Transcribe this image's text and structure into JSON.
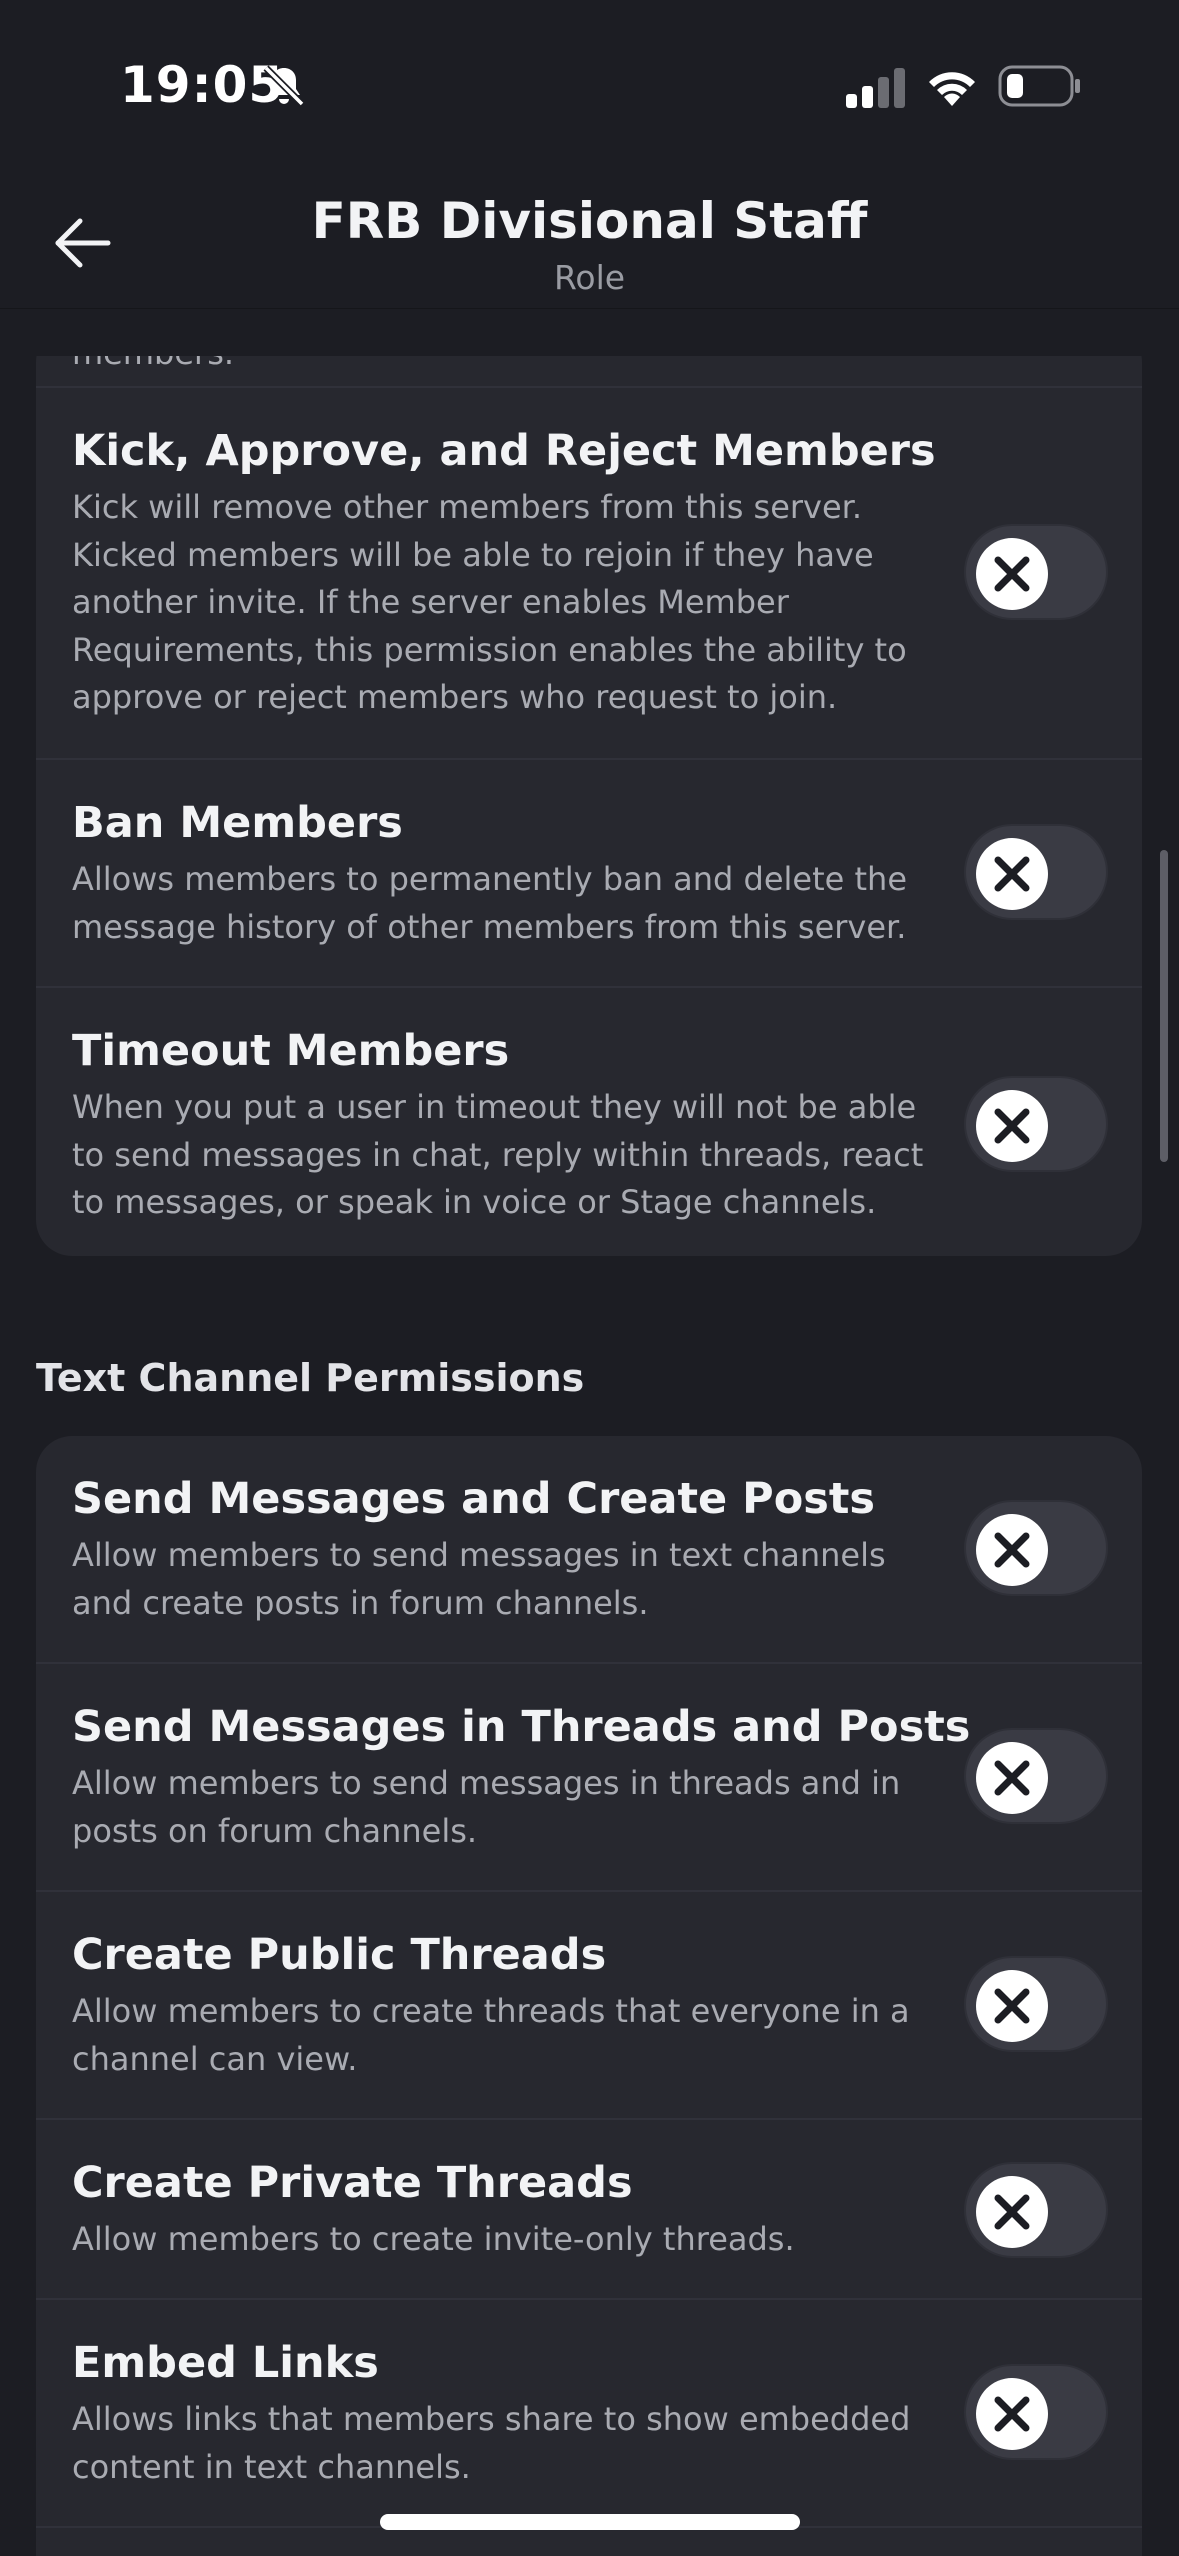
{
  "status_bar": {
    "time": "19:05"
  },
  "header": {
    "title": "FRB Divisional Staff",
    "subtitle": "Role"
  },
  "clipped_text": "members.",
  "membership_permissions": [
    {
      "title": "Kick, Approve, and Reject Members",
      "description": "Kick will remove other members from this server. Kicked members will be able to rejoin if they have another invite. If the server enables Member Requirements, this permission enables the ability to approve or reject members who request to join.",
      "enabled": false
    },
    {
      "title": "Ban Members",
      "description": "Allows members to permanently ban and delete the message history of other members from this server.",
      "enabled": false
    },
    {
      "title": "Timeout Members",
      "description": "When you put a user in timeout they will not be able to send messages in chat, reply within threads, react to messages, or speak in voice or Stage channels.",
      "enabled": false
    }
  ],
  "text_section": {
    "title": "Text Channel Permissions",
    "permissions": [
      {
        "title": "Send Messages and Create Posts",
        "description": "Allow members to send messages in text channels and create posts in forum channels.",
        "enabled": false
      },
      {
        "title": "Send Messages in Threads and Posts",
        "description": "Allow members to send messages in threads and in posts on forum channels.",
        "enabled": false
      },
      {
        "title": "Create Public Threads",
        "description": "Allow members to create threads that everyone in a channel can view.",
        "enabled": false
      },
      {
        "title": "Create Private Threads",
        "description": "Allow members to create invite-only threads.",
        "enabled": false
      },
      {
        "title": "Embed Links",
        "description": "Allows links that members share to show embedded content in text channels.",
        "enabled": false
      }
    ]
  },
  "icons": {
    "back": "arrow-left-icon",
    "mute": "bell-slash-icon",
    "signal": "cellular-signal-icon",
    "wifi": "wifi-icon",
    "battery": "battery-icon",
    "toggle_off": "x-icon"
  },
  "colors": {
    "background": "#1c1d23",
    "card": "#27282f",
    "toggle_track": "#3a3b44",
    "text_muted": "#a9abb2"
  }
}
